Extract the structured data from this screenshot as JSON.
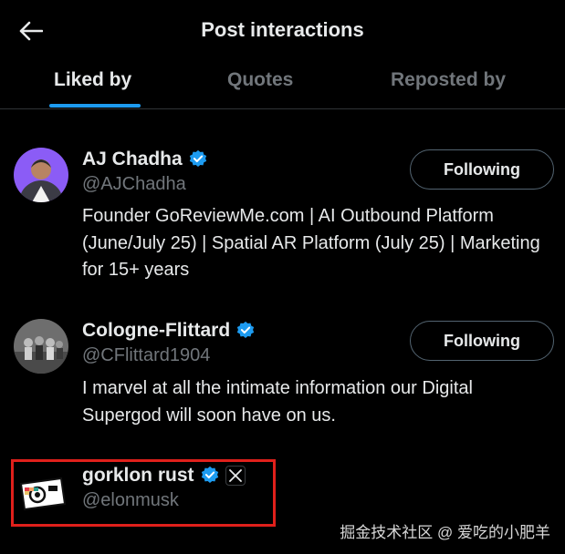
{
  "header": {
    "title": "Post interactions"
  },
  "tabs": [
    {
      "label": "Liked by",
      "active": true
    },
    {
      "label": "Quotes",
      "active": false
    },
    {
      "label": "Reposted by",
      "active": false
    }
  ],
  "users": [
    {
      "name": "AJ Chadha",
      "handle": "@AJChadha",
      "verified": true,
      "bio": "Founder GoReviewMe.com | AI Outbound Platform (June/July 25) | Spatial AR Platform (July 25) | Marketing for 15+ years",
      "follow_label": "Following"
    },
    {
      "name": "Cologne-Flittard",
      "handle": "@CFlittard1904",
      "verified": true,
      "bio": "I marvel at all the intimate information our Digital Supergod will soon have on us.",
      "follow_label": "Following"
    },
    {
      "name": "gorklon rust",
      "handle": "@elonmusk",
      "verified": true,
      "affiliate_badge": "x-logo-icon"
    }
  ],
  "watermark": "掘金技术社区 @ 爱吃的小肥羊",
  "colors": {
    "background": "#000000",
    "accent": "#1d9bf0",
    "muted_text": "#71767b",
    "highlight_box": "#e0201b"
  }
}
